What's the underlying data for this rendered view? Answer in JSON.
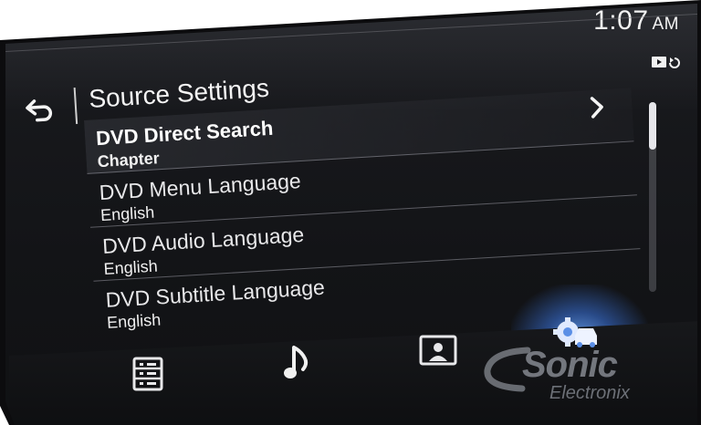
{
  "status_bar": {
    "time": "1:07",
    "ampm": "AM"
  },
  "header": {
    "title": "Source Settings"
  },
  "settings": [
    {
      "title": "DVD Direct Search",
      "value": "Chapter",
      "selected": true,
      "has_chevron": true
    },
    {
      "title": "DVD Menu Language",
      "value": "English",
      "selected": false
    },
    {
      "title": "DVD Audio Language",
      "value": "English",
      "selected": false
    },
    {
      "title": "DVD Subtitle Language",
      "value": "English",
      "selected": false
    }
  ],
  "scrollbar": {
    "position": 0.0,
    "visible_fraction": 0.25
  },
  "bottom_nav": [
    {
      "icon": "list-icon",
      "active": false
    },
    {
      "icon": "music-note-icon",
      "active": false
    },
    {
      "icon": "contact-card-icon",
      "active": false
    },
    {
      "icon": "settings-car-icon",
      "active": true
    }
  ],
  "watermark": {
    "brand": "Sonic",
    "sub": "Electronix"
  },
  "colors": {
    "background": "#131417",
    "text": "#f0f0f0",
    "accent_glow": "#5a9bff",
    "divider": "#b4b4be"
  }
}
